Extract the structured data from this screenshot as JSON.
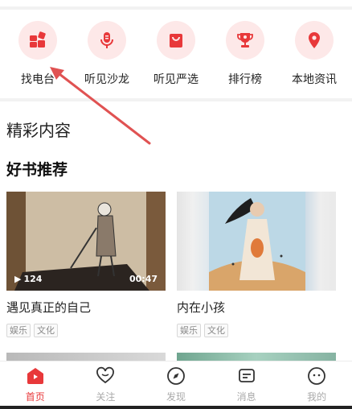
{
  "colors": {
    "accent": "#e8383a",
    "accent_light": "#fde8e8",
    "annotation_arrow": "#e05252"
  },
  "quick_nav": [
    {
      "label": "找电台",
      "icon": "radio-grid-icon"
    },
    {
      "label": "听见沙龙",
      "icon": "microphone-icon"
    },
    {
      "label": "听见严选",
      "icon": "shopping-bag-icon"
    },
    {
      "label": "排行榜",
      "icon": "trophy-icon"
    },
    {
      "label": "本地资讯",
      "icon": "location-pin-icon"
    }
  ],
  "section": {
    "title": "精彩内容",
    "subtitle": "好书推荐"
  },
  "cards": [
    {
      "title": "遇见真正的自己",
      "play_count": "124",
      "duration": "00:47",
      "tags": [
        "娱乐",
        "文化"
      ]
    },
    {
      "title": "内在小孩",
      "tags": [
        "娱乐",
        "文化"
      ]
    }
  ],
  "tab_bar": [
    {
      "label": "首页",
      "icon": "home-icon",
      "active": true
    },
    {
      "label": "关注",
      "icon": "heart-icon",
      "active": false
    },
    {
      "label": "发现",
      "icon": "compass-icon",
      "active": false
    },
    {
      "label": "消息",
      "icon": "message-icon",
      "active": false
    },
    {
      "label": "我的",
      "icon": "profile-icon",
      "active": false
    }
  ]
}
